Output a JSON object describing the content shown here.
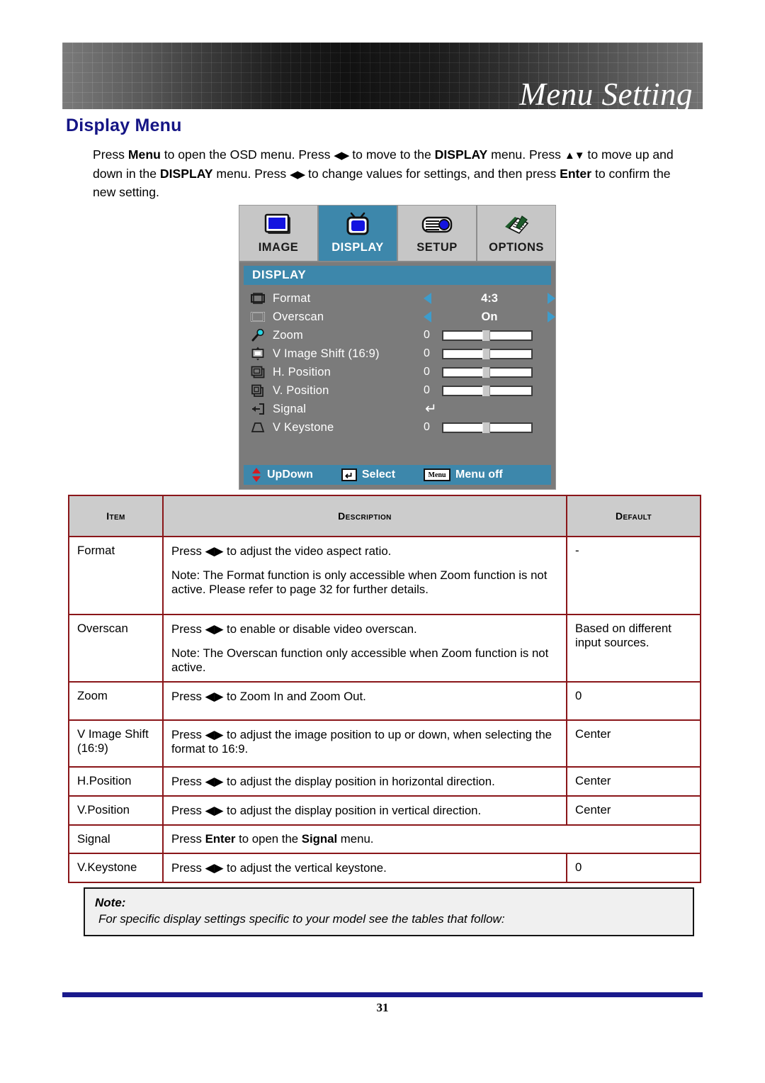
{
  "banner": {
    "title": "Menu Setting"
  },
  "heading": "Display Menu",
  "intro": {
    "part1": "Press ",
    "b1": "Menu",
    "part2": " to open the OSD menu. Press ",
    "arrows1": "◀▶",
    "part3": " to move to the ",
    "b2": "DISPLAY",
    "part4": " menu. Press ",
    "arrows2": "▲▼",
    "part5": " to move up and down in the ",
    "b3": "DISPLAY",
    "part6": " menu. Press ",
    "arrows3": "◀▶",
    "part7": " to change values for settings, and then press ",
    "b4": "Enter",
    "part8": " to confirm the new setting."
  },
  "osd": {
    "tabs": [
      {
        "label": "IMAGE",
        "icon": "image-screen-icon",
        "selected": false
      },
      {
        "label": "DISPLAY",
        "icon": "television-icon",
        "selected": true
      },
      {
        "label": "SETUP",
        "icon": "projector-icon",
        "selected": false
      },
      {
        "label": "OPTIONS",
        "icon": "notepad-pencil-icon",
        "selected": false
      }
    ],
    "title": "DISPLAY",
    "rows": [
      {
        "label": "Format",
        "icon": "format-frame-icon",
        "type": "value",
        "value": "4:3"
      },
      {
        "label": "Overscan",
        "icon": "overscan-frame-icon",
        "type": "value",
        "value": "On"
      },
      {
        "label": "Zoom",
        "icon": "magnifier-icon",
        "type": "slider",
        "value": "0",
        "thumb_pct": 44
      },
      {
        "label": "V Image Shift (16:9)",
        "icon": "image-shift-icon",
        "type": "slider",
        "value": "0",
        "thumb_pct": 44
      },
      {
        "label": "H. Position",
        "icon": "h-position-icon",
        "type": "slider",
        "value": "0",
        "thumb_pct": 44
      },
      {
        "label": "V. Position",
        "icon": "v-position-icon",
        "type": "slider",
        "value": "0",
        "thumb_pct": 44
      },
      {
        "label": "Signal",
        "icon": "signal-input-icon",
        "type": "enter",
        "value": "↵"
      },
      {
        "label": "V Keystone",
        "icon": "keystone-icon",
        "type": "slider",
        "value": "0",
        "thumb_pct": 44
      }
    ],
    "hints": [
      {
        "key_icon": "up-down-arrows-icon",
        "label": "UpDown",
        "key_text": ""
      },
      {
        "key_icon": "enter-key-icon",
        "label": "Select",
        "key_text": "↵"
      },
      {
        "key_icon": "menu-key-icon",
        "label": "Menu off",
        "key_text": "Menu"
      }
    ]
  },
  "table": {
    "headers": {
      "item": "Item",
      "description": "Description",
      "default": "Default"
    },
    "rows": [
      {
        "item": "Format",
        "desc_lines": [
          "Press ◀▶ to adjust the video aspect ratio.",
          "Note: The Format function is only accessible when Zoom function is not active. Please refer to page 32 for further details."
        ],
        "default": "-"
      },
      {
        "item": "Overscan",
        "desc_lines": [
          "Press ◀▶ to enable or disable video overscan.",
          "Note: The Overscan function only accessible when Zoom function is not active."
        ],
        "default": "Based on different input sources."
      },
      {
        "item": "Zoom",
        "desc_lines": [
          "Press ◀▶ to Zoom In and Zoom Out."
        ],
        "default": "0"
      },
      {
        "item": "V Image Shift (16:9)",
        "desc_lines": [
          "Press ◀▶ to adjust the image position to up or down, when selecting the format to 16:9."
        ],
        "default": "Center"
      },
      {
        "item": "H.Position",
        "desc_lines": [
          "Press ◀▶ to adjust the display position in horizontal direction."
        ],
        "default": "Center"
      },
      {
        "item": "V.Position",
        "desc_lines": [
          "Press ◀▶ to adjust the display position in vertical direction."
        ],
        "default": "Center"
      },
      {
        "item": "Signal",
        "desc_html": true,
        "desc_prefix": "Press ",
        "desc_bold1": "Enter",
        "desc_mid": " to open the ",
        "desc_bold2": "Signal",
        "desc_suffix": " menu.",
        "merged": true
      },
      {
        "item": "V.Keystone",
        "desc_lines": [
          "Press ◀▶ to adjust the vertical keystone."
        ],
        "default": "0"
      }
    ]
  },
  "note": {
    "label": "Note:",
    "text": "For specific display settings specific to your model see the tables that follow:"
  },
  "footer": {
    "page_number": "31"
  },
  "colors": {
    "heading_navy": "#151585",
    "osd_accent_teal": "#3d87ab",
    "table_border_red": "#8a1619",
    "table_header_gray": "#cccccc",
    "footer_rule_navy": "#1a1a8c"
  }
}
